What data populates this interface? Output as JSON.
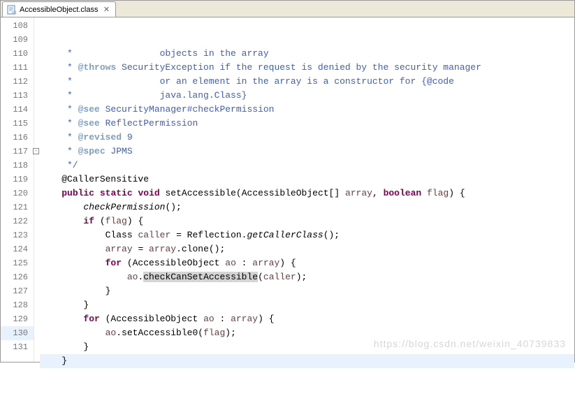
{
  "tab": {
    "title": "AccessibleObject.class",
    "close_glyph": "✕"
  },
  "gutter": {
    "start": 108,
    "count": 24,
    "fold_at": 117,
    "current": 130
  },
  "code": {
    "lines": [
      {
        "t": "jdoc",
        "indent": " *                ",
        "text": "objects in the array"
      },
      {
        "t": "jtag",
        "indent": " * ",
        "tag": "@throws",
        "text": " SecurityException if the request is denied by the security manager"
      },
      {
        "t": "jdoc",
        "indent": " *                ",
        "text": "or an element in the array is a constructor for {@code"
      },
      {
        "t": "jdoc",
        "indent": " *                ",
        "text": "java.lang.Class}"
      },
      {
        "t": "jtag",
        "indent": " * ",
        "tag": "@see",
        "text": " SecurityManager#checkPermission"
      },
      {
        "t": "jtag",
        "indent": " * ",
        "tag": "@see",
        "text": " ReflectPermission"
      },
      {
        "t": "jtag",
        "indent": " * ",
        "tag": "@revised",
        "text": " 9"
      },
      {
        "t": "jtag",
        "indent": " * ",
        "tag": "@spec",
        "text": " JPMS"
      },
      {
        "t": "jdoc",
        "indent": " ",
        "text": "*/"
      },
      {
        "t": "anno",
        "indent": "",
        "text": "@CallerSensitive"
      },
      {
        "t": "sig"
      },
      {
        "t": "call",
        "indent": "    ",
        "ital": "checkPermission",
        "rest": "();"
      },
      {
        "t": "if",
        "indent": "    ",
        "kw": "if",
        "rest": " (",
        "var": "flag",
        "tail": ") {"
      },
      {
        "t": "decl",
        "indent": "        ",
        "pre": "Class<?> ",
        "var": "caller",
        "rest": " = Reflection.",
        "ital": "getCallerClass",
        "tail": "();"
      },
      {
        "t": "assign",
        "indent": "        ",
        "var": "array",
        "rest": " = ",
        "var2": "array",
        "tail": ".clone();"
      },
      {
        "t": "for",
        "indent": "        ",
        "kw": "for",
        "rest": " (AccessibleObject ",
        "var": "ao",
        "mid": " : ",
        "var2": "array",
        "tail": ") {"
      },
      {
        "t": "aocall",
        "indent": "            ",
        "var": "ao",
        "dot": ".",
        "hl": "checkCanSetAccessible",
        "rest": "(",
        "var2": "caller",
        "tail": ");"
      },
      {
        "t": "plain",
        "indent": "        ",
        "text": "}"
      },
      {
        "t": "plain",
        "indent": "    ",
        "text": "}"
      },
      {
        "t": "for",
        "indent": "    ",
        "kw": "for",
        "rest": " (AccessibleObject ",
        "var": "ao",
        "mid": " : ",
        "var2": "array",
        "tail": ") {"
      },
      {
        "t": "aocall2",
        "indent": "        ",
        "var": "ao",
        "dot": ".",
        "m": "setAccessible0",
        "rest": "(",
        "var2": "flag",
        "tail": ");"
      },
      {
        "t": "plain",
        "indent": "    ",
        "text": "}"
      },
      {
        "t": "plain",
        "indent": "",
        "text": "}",
        "current": true
      },
      {
        "t": "empty"
      }
    ],
    "signature": {
      "kw1": "public",
      "kw2": "static",
      "kw3": "void",
      "name": "setAccessible",
      "params_open": "(AccessibleObject[] ",
      "p1": "array",
      "sep": ", ",
      "kw4": "boolean",
      "sp": " ",
      "p2": "flag",
      "close": ") {"
    }
  },
  "watermark": "https://blog.csdn.net/weixin_40739833"
}
